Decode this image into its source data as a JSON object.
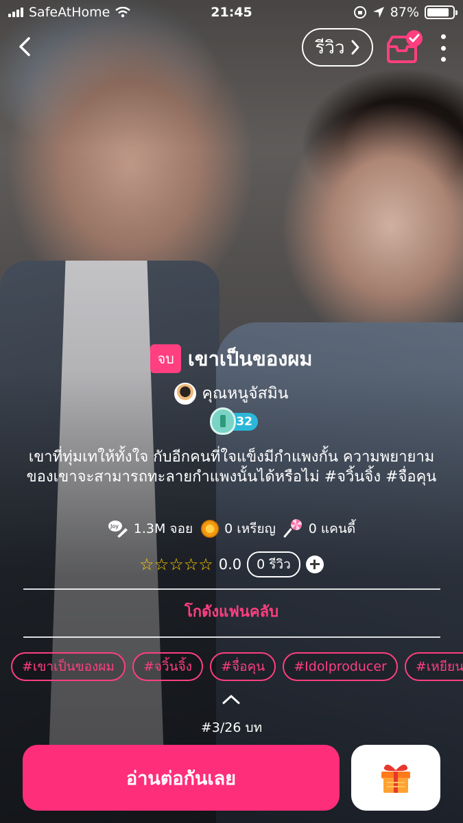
{
  "status_bar": {
    "carrier": "SafeAtHome",
    "time": "21:45",
    "battery": "87%",
    "battery_level": 0.87
  },
  "nav": {
    "review_label": "รีวิว"
  },
  "story": {
    "status_badge": "จบ",
    "title": "เขาเป็นของผม",
    "author": "คุณหนูจัสมิน",
    "author_level": "32",
    "description": "เขาที่ทุ่มเทให้ทั้งใจ กับอีกคนที่ใจแข็งมีกำแพงกั้น ความพยายามของเขาจะสามารถทะลายกำแพงนั้นได้หรือไม่ #จวิ้นจิ้ง #จื่อคุน"
  },
  "stats": {
    "joy": "1.3M จอย",
    "coins": "0 เหรียญ",
    "candy": "0 แคนดี้"
  },
  "rating": {
    "stars": "☆☆☆☆☆",
    "score": "0.0",
    "reviews": "0 รีวิว"
  },
  "fanclub_label": "โกดังแฟนคลับ",
  "tags": [
    "#เขาเป็นของผม",
    "#จวิ้นจิ้ง",
    "#จื่อคุน",
    "#Idolproducer",
    "#เหยียนจิ้ง"
  ],
  "chapter_info": "#3/26 บท",
  "read_button_label": "อ่านต่อกันเลย",
  "colors": {
    "accent": "#ff2e7a",
    "level_badge": "#2cb7d9",
    "star": "#ffcc00"
  }
}
